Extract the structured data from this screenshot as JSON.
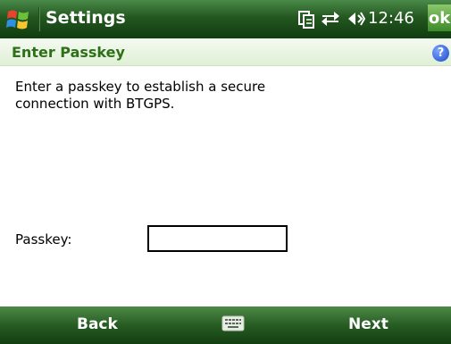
{
  "titlebar": {
    "app_title": "Settings",
    "time": "12:46",
    "ok_label": "ok",
    "icons": [
      "windows-start-icon",
      "clipboard-icon",
      "connectivity-icon",
      "volume-icon"
    ]
  },
  "header": {
    "title": "Enter Passkey",
    "help_icon": "help-icon",
    "help_glyph": "?"
  },
  "content": {
    "instructions": "Enter a passkey to establish a secure connection with BTGPS.",
    "passkey_label": "Passkey:",
    "passkey_value": "",
    "passkey_placeholder": ""
  },
  "softkeys": {
    "left_label": "Back",
    "right_label": "Next",
    "center_icon": "keyboard-icon"
  },
  "colors": {
    "bar_green": "#23571f",
    "header_text_green": "#2f6f1a",
    "ok_green": "#4ea03a"
  }
}
